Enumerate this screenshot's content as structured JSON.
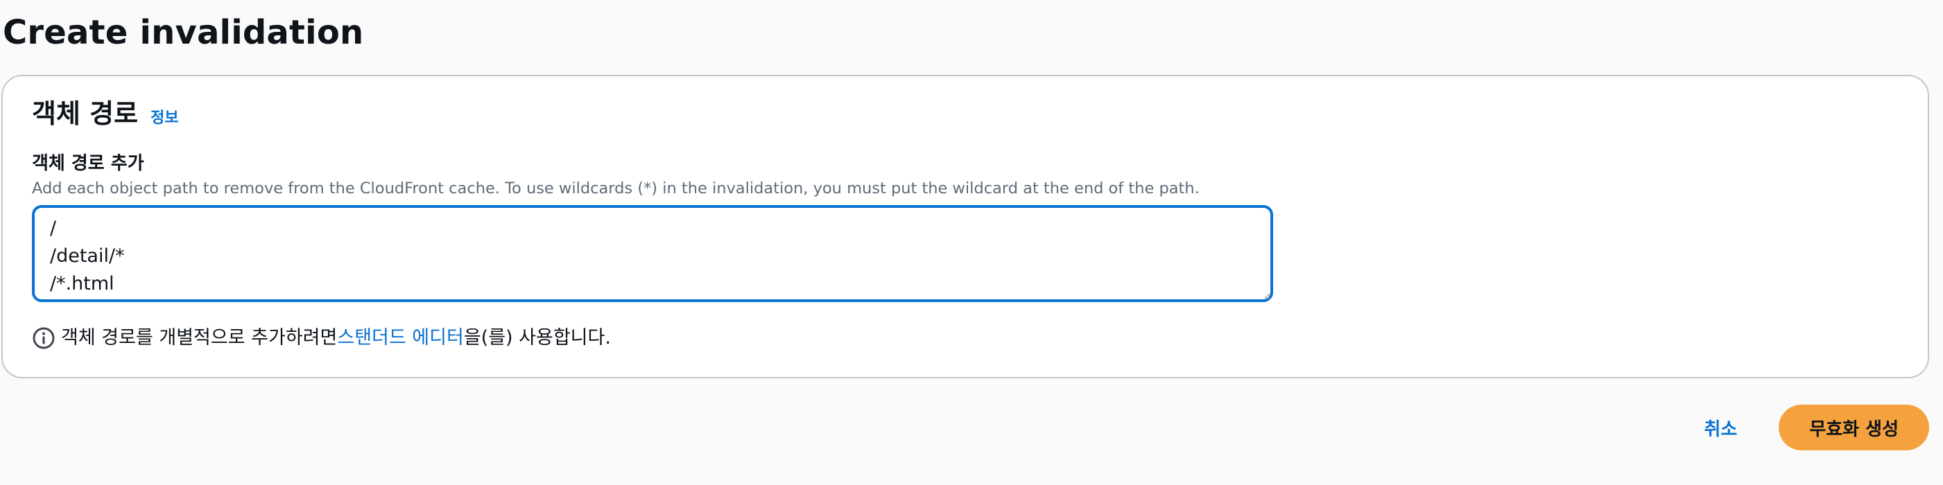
{
  "page": {
    "title": "Create invalidation"
  },
  "object_paths": {
    "title": "객체 경로",
    "info_link": "정보",
    "field_label": "객체 경로 추가",
    "field_description": "Add each object path to remove from the CloudFront cache. To use wildcards (*) in the invalidation, you must put the wildcard at the end of the path.",
    "paths_value": "/\n/detail/*\n/*.html",
    "hint_prefix": "객체 경로를 개별적으로 추가하려면 ",
    "hint_link": "스탠더드 에디터",
    "hint_suffix": "을(를) 사용합니다.",
    "hint_icon": "info-circle-icon"
  },
  "actions": {
    "cancel_label": "취소",
    "create_label": "무효화 생성"
  },
  "colors": {
    "link": "#0972d3",
    "primary_button": "#f5a13d",
    "focus_border": "#0972d3"
  }
}
